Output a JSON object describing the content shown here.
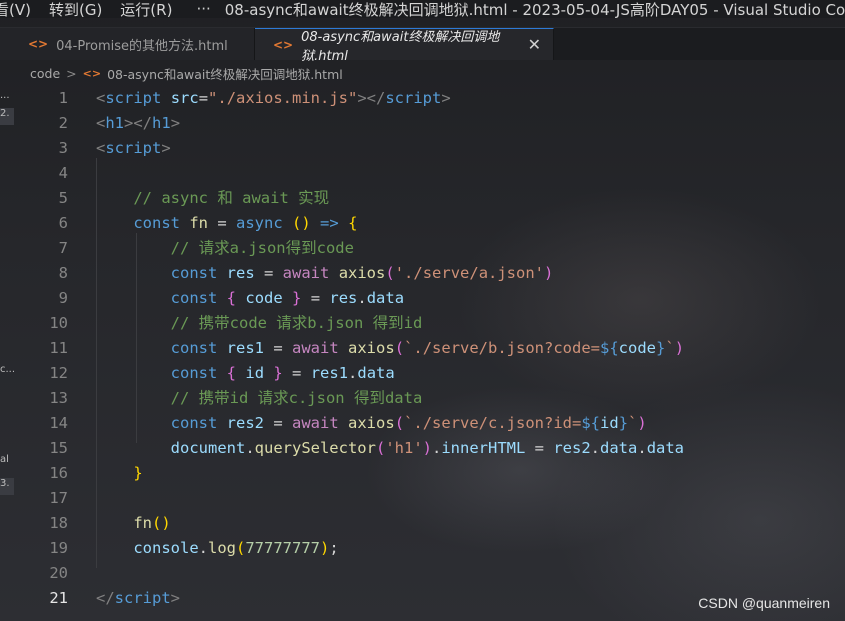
{
  "window": {
    "menu_items": [
      "看(V)",
      "转到(G)",
      "运行(R)"
    ],
    "more": "···",
    "title": "08-async和await终极解决回调地狱.html - 2023-05-04-JS高阶DAY05 - Visual Studio Code"
  },
  "tabs": [
    {
      "icon": "<>",
      "label": "04-Promise的其他方法.html",
      "active": false
    },
    {
      "icon": "<>",
      "label": "08-async和await终极解决回调地狱.html",
      "active": true,
      "close": "✕"
    }
  ],
  "breadcrumb": {
    "folder": "code",
    "separator": ">",
    "file_icon": "<>",
    "file": "08-async和await终极解决回调地狱.html"
  },
  "left_strip": [
    "...",
    "2.",
    "c...",
    "al",
    "3."
  ],
  "line_numbers": [
    "1",
    "2",
    "3",
    "4",
    "5",
    "6",
    "7",
    "8",
    "9",
    "10",
    "11",
    "12",
    "13",
    "14",
    "15",
    "16",
    "17",
    "18",
    "19",
    "20",
    "21"
  ],
  "current_line": "21",
  "code_lines": [
    [
      [
        "t-br",
        "<"
      ],
      [
        "t-tag",
        "script"
      ],
      [
        "t-op",
        " "
      ],
      [
        "t-attr",
        "src"
      ],
      [
        "t-op",
        "="
      ],
      [
        "t-str",
        "\"./axios.min.js\""
      ],
      [
        "t-br",
        "></"
      ],
      [
        "t-tag",
        "script"
      ],
      [
        "t-br",
        ">"
      ]
    ],
    [
      [
        "t-br",
        "<"
      ],
      [
        "t-tag",
        "h1"
      ],
      [
        "t-br",
        "></"
      ],
      [
        "t-tag",
        "h1"
      ],
      [
        "t-br",
        ">"
      ]
    ],
    [
      [
        "t-br",
        "<"
      ],
      [
        "t-tag",
        "script"
      ],
      [
        "t-br",
        ">"
      ]
    ],
    [],
    [
      [
        "t-op",
        "    "
      ],
      [
        "t-cmt",
        "// async 和 await 实现"
      ]
    ],
    [
      [
        "t-op",
        "    "
      ],
      [
        "t-kw",
        "const"
      ],
      [
        "t-op",
        " "
      ],
      [
        "t-fn",
        "fn"
      ],
      [
        "t-op",
        " = "
      ],
      [
        "t-kw",
        "async"
      ],
      [
        "t-op",
        " "
      ],
      [
        "t-brace",
        "()"
      ],
      [
        "t-op",
        " "
      ],
      [
        "t-kw",
        "=>"
      ],
      [
        "t-op",
        " "
      ],
      [
        "t-brace",
        "{"
      ]
    ],
    [
      [
        "t-op",
        "        "
      ],
      [
        "t-cmt",
        "// 请求a.json得到code"
      ]
    ],
    [
      [
        "t-op",
        "        "
      ],
      [
        "t-kw",
        "const"
      ],
      [
        "t-op",
        " "
      ],
      [
        "t-var",
        "res"
      ],
      [
        "t-op",
        " = "
      ],
      [
        "t-ctrl",
        "await"
      ],
      [
        "t-op",
        " "
      ],
      [
        "t-fn",
        "axios"
      ],
      [
        "t-paren",
        "("
      ],
      [
        "t-str",
        "'./serve/a.json'"
      ],
      [
        "t-paren",
        ")"
      ]
    ],
    [
      [
        "t-op",
        "        "
      ],
      [
        "t-kw",
        "const"
      ],
      [
        "t-op",
        " "
      ],
      [
        "t-paren",
        "{"
      ],
      [
        "t-op",
        " "
      ],
      [
        "t-var",
        "code"
      ],
      [
        "t-op",
        " "
      ],
      [
        "t-paren",
        "}"
      ],
      [
        "t-op",
        " = "
      ],
      [
        "t-var",
        "res"
      ],
      [
        "t-op",
        "."
      ],
      [
        "t-var",
        "data"
      ]
    ],
    [
      [
        "t-op",
        "        "
      ],
      [
        "t-cmt",
        "// 携带code 请求b.json 得到id"
      ]
    ],
    [
      [
        "t-op",
        "        "
      ],
      [
        "t-kw",
        "const"
      ],
      [
        "t-op",
        " "
      ],
      [
        "t-var",
        "res1"
      ],
      [
        "t-op",
        " = "
      ],
      [
        "t-ctrl",
        "await"
      ],
      [
        "t-op",
        " "
      ],
      [
        "t-fn",
        "axios"
      ],
      [
        "t-paren",
        "("
      ],
      [
        "t-str",
        "`./serve/b.json?code="
      ],
      [
        "t-kw",
        "${"
      ],
      [
        "t-var",
        "code"
      ],
      [
        "t-kw",
        "}"
      ],
      [
        "t-str",
        "`"
      ],
      [
        "t-paren",
        ")"
      ]
    ],
    [
      [
        "t-op",
        "        "
      ],
      [
        "t-kw",
        "const"
      ],
      [
        "t-op",
        " "
      ],
      [
        "t-paren",
        "{"
      ],
      [
        "t-op",
        " "
      ],
      [
        "t-var",
        "id"
      ],
      [
        "t-op",
        " "
      ],
      [
        "t-paren",
        "}"
      ],
      [
        "t-op",
        " = "
      ],
      [
        "t-var",
        "res1"
      ],
      [
        "t-op",
        "."
      ],
      [
        "t-var",
        "data"
      ]
    ],
    [
      [
        "t-op",
        "        "
      ],
      [
        "t-cmt",
        "// 携带id 请求c.json 得到data"
      ]
    ],
    [
      [
        "t-op",
        "        "
      ],
      [
        "t-kw",
        "const"
      ],
      [
        "t-op",
        " "
      ],
      [
        "t-var",
        "res2"
      ],
      [
        "t-op",
        " = "
      ],
      [
        "t-ctrl",
        "await"
      ],
      [
        "t-op",
        " "
      ],
      [
        "t-fn",
        "axios"
      ],
      [
        "t-paren",
        "("
      ],
      [
        "t-str",
        "`./serve/c.json?id="
      ],
      [
        "t-kw",
        "${"
      ],
      [
        "t-var",
        "id"
      ],
      [
        "t-kw",
        "}"
      ],
      [
        "t-str",
        "`"
      ],
      [
        "t-paren",
        ")"
      ]
    ],
    [
      [
        "t-op",
        "        "
      ],
      [
        "t-var",
        "document"
      ],
      [
        "t-op",
        "."
      ],
      [
        "t-fn",
        "querySelector"
      ],
      [
        "t-paren",
        "("
      ],
      [
        "t-str",
        "'h1'"
      ],
      [
        "t-paren",
        ")"
      ],
      [
        "t-op",
        "."
      ],
      [
        "t-var",
        "innerHTML"
      ],
      [
        "t-op",
        " = "
      ],
      [
        "t-var",
        "res2"
      ],
      [
        "t-op",
        "."
      ],
      [
        "t-var",
        "data"
      ],
      [
        "t-op",
        "."
      ],
      [
        "t-var",
        "data"
      ]
    ],
    [
      [
        "t-op",
        "    "
      ],
      [
        "t-brace",
        "}"
      ]
    ],
    [],
    [
      [
        "t-op",
        "    "
      ],
      [
        "t-fn",
        "fn"
      ],
      [
        "t-brace",
        "()"
      ]
    ],
    [
      [
        "t-op",
        "    "
      ],
      [
        "t-var",
        "console"
      ],
      [
        "t-op",
        "."
      ],
      [
        "t-fn",
        "log"
      ],
      [
        "t-brace",
        "("
      ],
      [
        "t-num",
        "77777777"
      ],
      [
        "t-brace",
        ")"
      ],
      [
        "t-op",
        ";"
      ]
    ],
    [],
    [
      [
        "t-br",
        "</"
      ],
      [
        "t-tag",
        "script"
      ],
      [
        "t-br",
        ">"
      ]
    ]
  ],
  "watermark": "CSDN @quanmeiren"
}
